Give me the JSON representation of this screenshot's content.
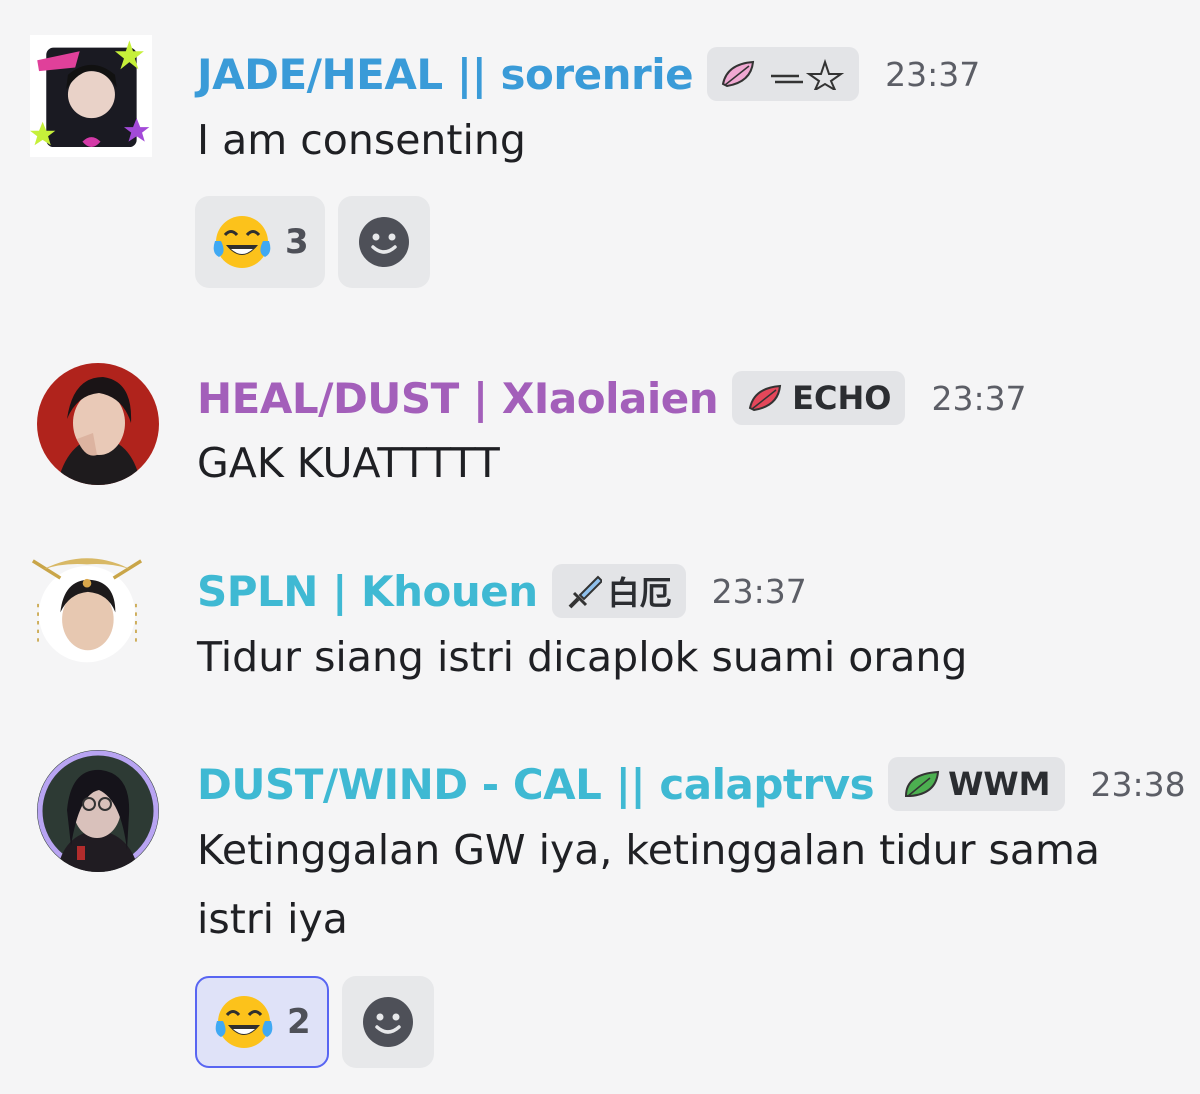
{
  "messages": [
    {
      "username": "JADE/HEAL || sorenrie",
      "username_color": "#3a9bd8",
      "tag_label": "",
      "tag_icon": "pink-feather-icon",
      "tag_icon_color": "#f0a8d2",
      "time": "23:37",
      "text": "I am consenting",
      "reactions": [
        {
          "emoji": "😂",
          "count": "3",
          "active": false
        }
      ]
    },
    {
      "username": "HEAL/DUST | XIaolaien",
      "username_color": "#a35fba",
      "tag_label": "ECHO",
      "tag_icon": "red-feather-icon",
      "tag_icon_color": "#e4475a",
      "time": "23:37",
      "text": "GAK KUATTTTT",
      "reactions": []
    },
    {
      "username": "SPLN | Khouen",
      "username_color": "#3fb9d3",
      "tag_label": "白厄",
      "tag_icon": "sword-icon",
      "tag_icon_color": "#6fa3d4",
      "time": "23:37",
      "text": "Tidur siang istri dicaplok suami orang",
      "reactions": []
    },
    {
      "username": "DUST/WIND - CAL || calaptrvs",
      "username_color": "#3fb9d3",
      "tag_label": "WWM",
      "tag_icon": "green-leaf-icon",
      "tag_icon_color": "#4caf50",
      "time": "23:38",
      "text": "Ketinggalan GW iya, ketinggalan tidur sama istri iya",
      "reactions": [
        {
          "emoji": "😂",
          "count": "2",
          "active": true
        }
      ]
    }
  ],
  "add_reaction_icon": "smiley-icon"
}
